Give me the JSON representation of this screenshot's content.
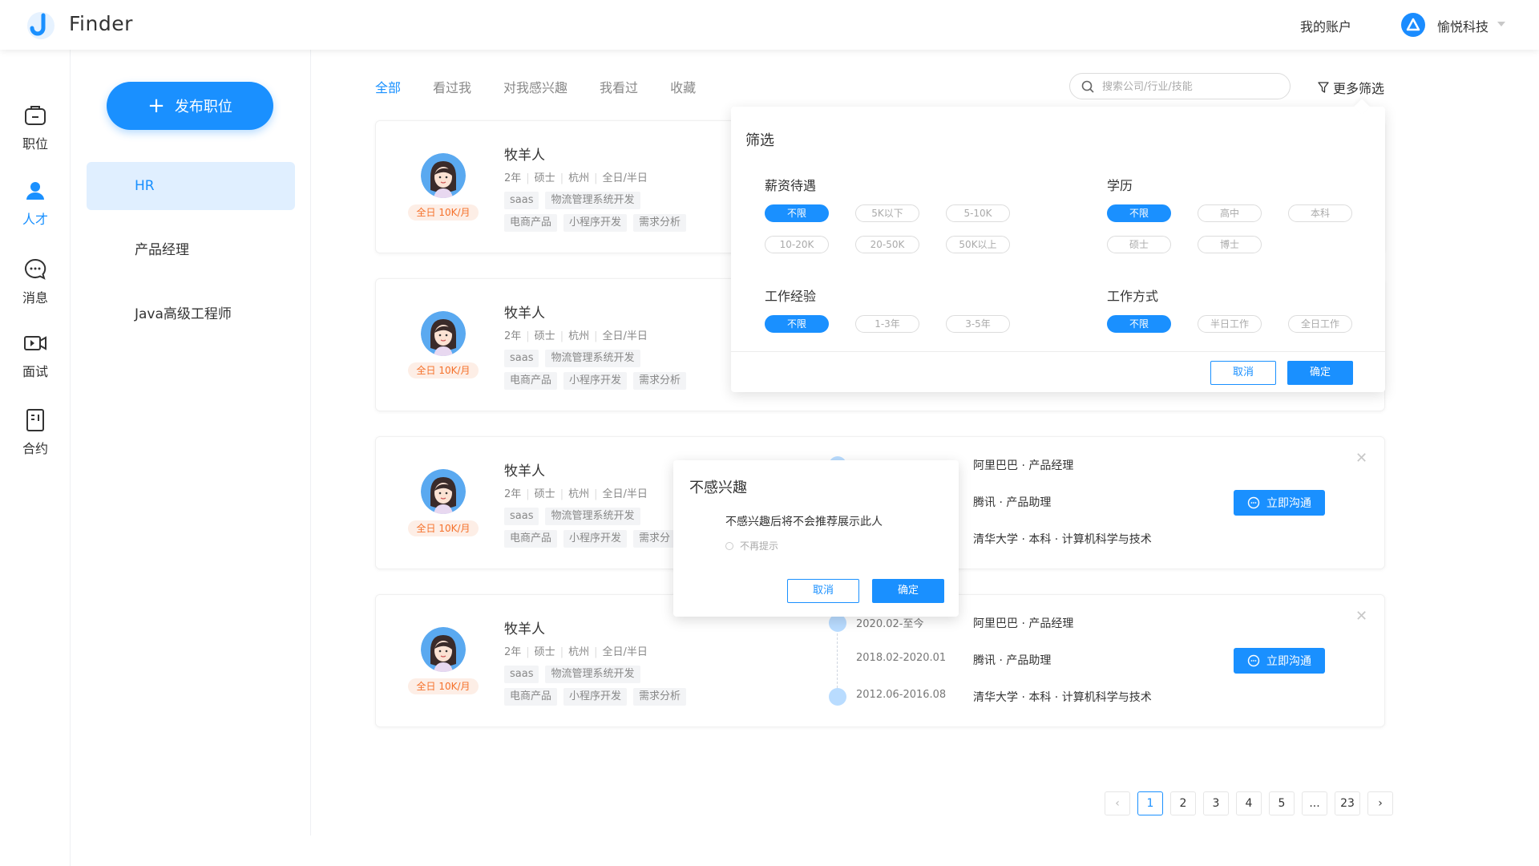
{
  "header": {
    "app_name": "Finder",
    "my_account": "我的账户",
    "org_name": "愉悦科技"
  },
  "leftnav": [
    {
      "label": "职位",
      "icon": "briefcase-icon"
    },
    {
      "label": "人才",
      "icon": "person-icon",
      "active": true
    },
    {
      "label": "消息",
      "icon": "chat-bubble-icon"
    },
    {
      "label": "面试",
      "icon": "video-camera-icon"
    },
    {
      "label": "合约",
      "icon": "contract-document-icon"
    }
  ],
  "jobs": {
    "publish_label": "发布职位",
    "items": [
      {
        "label": "HR",
        "active": true
      },
      {
        "label": "产品经理"
      },
      {
        "label": "Java高级工程师"
      }
    ]
  },
  "tabs": [
    {
      "label": "全部",
      "active": true
    },
    {
      "label": "看过我"
    },
    {
      "label": "对我感兴趣"
    },
    {
      "label": "我看过"
    },
    {
      "label": "收藏"
    }
  ],
  "search": {
    "placeholder": "搜索公司/行业/技能"
  },
  "more_filter_label": "更多筛选",
  "candidates": [
    {
      "name": "牧羊人",
      "years": "2年",
      "degree": "硕士",
      "city": "杭州",
      "worktype": "全日/半日",
      "salary": "全日 10K/月",
      "tags1": [
        "saas",
        "物流管理系统开发"
      ],
      "tags2": [
        "电商产品",
        "小程序开发",
        "需求分析"
      ]
    },
    {
      "name": "牧羊人",
      "years": "2年",
      "degree": "硕士",
      "city": "杭州",
      "worktype": "全日/半日",
      "salary": "全日 10K/月",
      "tags1": [
        "saas",
        "物流管理系统开发"
      ],
      "tags2": [
        "电商产品",
        "小程序开发",
        "需求分析"
      ]
    },
    {
      "name": "牧羊人",
      "years": "2年",
      "degree": "硕士",
      "city": "杭州",
      "worktype": "全日/半日",
      "salary": "全日 10K/月",
      "tags1": [
        "saas",
        "物流管理系统开发"
      ],
      "tags2": [
        "电商产品",
        "小程序开发",
        "需求分"
      ],
      "timeline": [
        {
          "date": "",
          "info": "阿里巴巴 · 产品经理"
        },
        {
          "date": "",
          "info": "腾讯 · 产品助理"
        },
        {
          "date": "",
          "info": "清华大学 · 本科 · 计算机科学与技术"
        }
      ],
      "chat_label": "立即沟通"
    },
    {
      "name": "牧羊人",
      "years": "2年",
      "degree": "硕士",
      "city": "杭州",
      "worktype": "全日/半日",
      "salary": "全日 10K/月",
      "tags1": [
        "saas",
        "物流管理系统开发"
      ],
      "tags2": [
        "电商产品",
        "小程序开发",
        "需求分析"
      ],
      "timeline": [
        {
          "date": "2020.02-至今",
          "info": "阿里巴巴 · 产品经理"
        },
        {
          "date": "2018.02-2020.01",
          "info": "腾讯 · 产品助理"
        },
        {
          "date": "2012.06-2016.08",
          "info": "清华大学 · 本科 · 计算机科学与技术"
        }
      ],
      "chat_label": "立即沟通"
    }
  ],
  "filter": {
    "title": "筛选",
    "salary": {
      "title": "薪资待遇",
      "options": [
        "不限",
        "5K以下",
        "5-10K",
        "10-20K",
        "20-50K",
        "50K以上"
      ],
      "selected": "不限"
    },
    "education": {
      "title": "学历",
      "options": [
        "不限",
        "高中",
        "本科",
        "硕士",
        "博士"
      ],
      "selected": "不限"
    },
    "experience": {
      "title": "工作经验",
      "options": [
        "不限",
        "1-3年",
        "3-5年"
      ],
      "selected": "不限"
    },
    "workmode": {
      "title": "工作方式",
      "options": [
        "不限",
        "半日工作",
        "全日工作"
      ],
      "selected": "不限"
    },
    "cancel_label": "取消",
    "ok_label": "确定"
  },
  "dialog": {
    "title": "不感兴趣",
    "message": "不感兴趣后将不会推荐展示此人",
    "checkbox_label": "不再提示",
    "cancel_label": "取消",
    "ok_label": "确定"
  },
  "pagination": {
    "pages": [
      "1",
      "2",
      "3",
      "4",
      "5",
      "...",
      "23"
    ],
    "current": "1"
  },
  "colors": {
    "accent": "#1a90ff",
    "salary_orange": "#f5712b"
  }
}
